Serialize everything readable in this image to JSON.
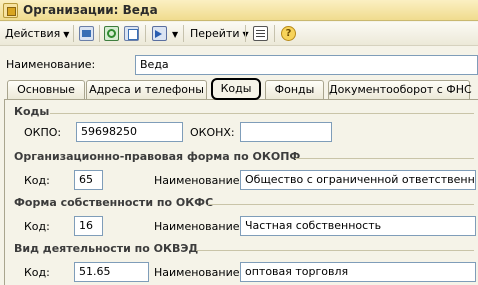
{
  "window": {
    "title": "Организации: Веда"
  },
  "toolbar": {
    "actions_label": "Действия",
    "goto_label": "Перейти"
  },
  "name_field": {
    "label": "Наименование:",
    "value": "Веда"
  },
  "tabs": [
    {
      "label": "Основные"
    },
    {
      "label": "Адреса и телефоны"
    },
    {
      "label": "Коды"
    },
    {
      "label": "Фонды"
    },
    {
      "label": "Документооборот с ФНС"
    }
  ],
  "codes": {
    "title": "Коды",
    "okpo_label": "ОКПО:",
    "okpo_value": "59698250",
    "okonh_label": "ОКОНХ:",
    "okonh_value": ""
  },
  "okopf": {
    "title": "Организационно-правовая форма по ОКОПФ",
    "code_label": "Код:",
    "code_value": "65",
    "name_label": "Наименование:",
    "name_value": "Общество с ограниченной ответственностью"
  },
  "okfs": {
    "title": "Форма собственности по ОКФС",
    "code_label": "Код:",
    "code_value": "16",
    "name_label": "Наименование:",
    "name_value": "Частная собственность"
  },
  "okved": {
    "title": "Вид деятельности по ОКВЭД",
    "code_label": "Код:",
    "code_value": "51.65",
    "name_label": "Наименование:",
    "name_value": "оптовая торговля"
  }
}
